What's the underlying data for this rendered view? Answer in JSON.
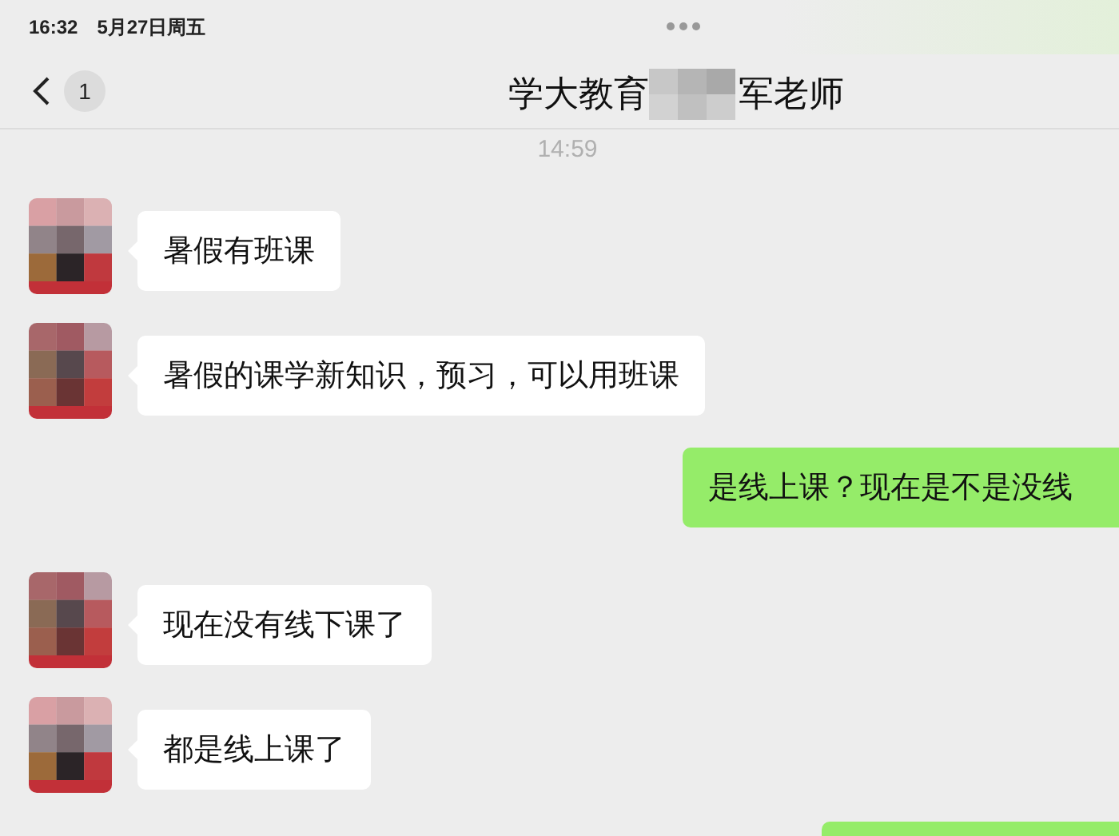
{
  "status_bar": {
    "time": "16:32",
    "date": "5月27日周五"
  },
  "header": {
    "back_badge": "1",
    "title_start": "学大教育",
    "title_end": "军老师"
  },
  "timestamp": "14:59",
  "messages": [
    {
      "kind": "incoming",
      "text": "暑假有班课"
    },
    {
      "kind": "incoming",
      "text": "暑假的课学新知识，预习，可以用班课"
    },
    {
      "kind": "outgoing",
      "text": "是线上课？现在是不是没线"
    },
    {
      "kind": "incoming",
      "text": "现在没有线下课了"
    },
    {
      "kind": "incoming",
      "text": "都是线上课了"
    },
    {
      "kind": "outgoing"
    }
  ]
}
